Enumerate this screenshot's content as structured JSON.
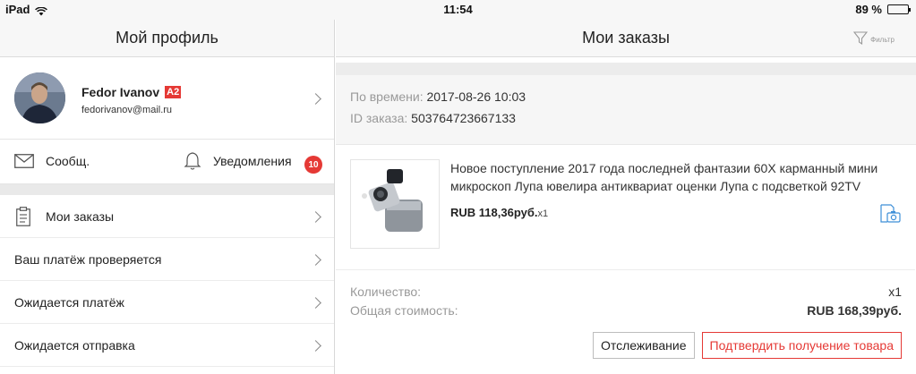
{
  "status_bar": {
    "device": "iPad",
    "time": "11:54",
    "battery": "89 %",
    "battery_level": 0.89
  },
  "left": {
    "title": "Мой профиль",
    "profile": {
      "name": "Fedor Ivanov",
      "badge": "A2",
      "email": "fedorivanov@mail.ru"
    },
    "messages_label": "Сообщ.",
    "notifications_label": "Уведомления",
    "notifications_count": "10",
    "menu": [
      {
        "label": "Мои заказы"
      },
      {
        "label": "Ваш платёж проверяется"
      },
      {
        "label": "Ожидается платёж"
      },
      {
        "label": "Ожидается отправка"
      }
    ]
  },
  "right": {
    "title": "Мои заказы",
    "filter_label": "Фильтр",
    "order": {
      "time_label": "По времени:",
      "time_value": "2017-08-26 10:03",
      "id_label": "ID заказа:",
      "id_value": "503764723667133",
      "product_title": "Новое поступление 2017 года последней фантазии 60X карманный мини микроскоп Лупа ювелира антиквариат оценки Лупа с подсветкой 92TV",
      "product_price": "RUB 118,36руб.",
      "product_qty": "x1",
      "quantity_label": "Количество:",
      "quantity_value": "x1",
      "total_label": "Общая стоимость:",
      "total_value": "RUB 168,39руб."
    },
    "buttons": {
      "track": "Отслеживание",
      "confirm": "Подтвердить получение товара"
    }
  },
  "colors": {
    "accent_red": "#e53935",
    "border": "#dcdcdc",
    "muted": "#999999"
  }
}
